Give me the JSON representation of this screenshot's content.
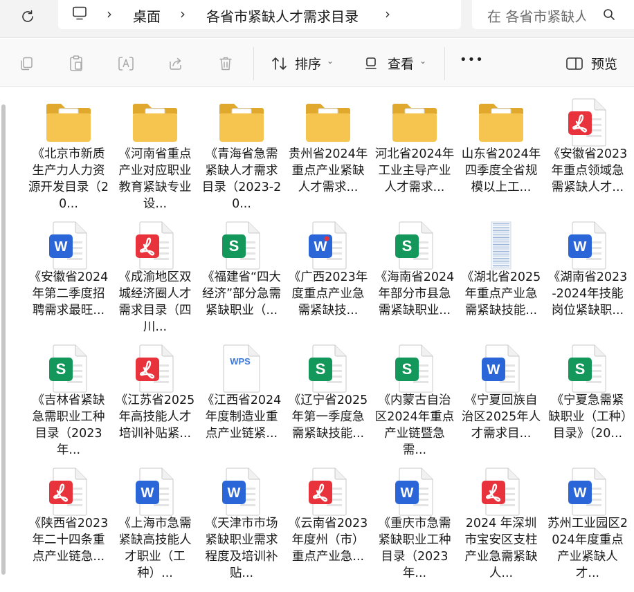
{
  "addressbar": {
    "crumbs": [
      "桌面",
      "各省市紧缺人才需求目录"
    ],
    "search_placeholder": "在 各省市紧缺人才需求目录 中搜索"
  },
  "toolbar": {
    "sort_label": "排序",
    "view_label": "查看",
    "more_label": "•••",
    "preview_label": "预览"
  },
  "colors": {
    "pdf": "#e8333c",
    "word": "#2b66d9",
    "sheet": "#14975a",
    "wps": "#3c78d8",
    "folder": "#f5c550"
  },
  "files": [
    {
      "type": "folder",
      "badge": "pdf",
      "name": "《北京市新质生产力人力资源开发目录（20..."
    },
    {
      "type": "folder",
      "badge": "pdf",
      "name": "《河南省重点产业对应职业教育紧缺专业设..."
    },
    {
      "type": "folder",
      "badge": "sheet",
      "name": "《青海省急需紧缺人才需求目录（2023-20..."
    },
    {
      "type": "folder",
      "badge": "sheet",
      "name": "贵州省2024年重点产业紧缺人才需求..."
    },
    {
      "type": "folder",
      "badge": "sheet",
      "name": "河北省2024年工业主导产业人才需求..."
    },
    {
      "type": "folder",
      "badge": "word",
      "name": "山东省2024年四季度全省规模以上工..."
    },
    {
      "type": "pdf",
      "name": "《安徽省2023年重点领域急需紧缺人才..."
    },
    {
      "type": "word",
      "name": "《安徽省2024年第二季度招聘需求最旺..."
    },
    {
      "type": "pdf",
      "name": "《成渝地区双城经济圈人才需求目录（四川..."
    },
    {
      "type": "sheet",
      "name": "《福建省“四大经济”部分急需紧缺职业（..."
    },
    {
      "type": "word-dot",
      "name": "《广西2023年度重点产业急需紧缺技..."
    },
    {
      "type": "sheet",
      "name": "《海南省2024年部分市县急需紧缺职业..."
    },
    {
      "type": "spreadsheet-thumb",
      "name": "《湖北省2025年重点产业急需紧缺技能..."
    },
    {
      "type": "word",
      "name": "《湖南省2023-2024年技能岗位紧缺职..."
    },
    {
      "type": "sheet",
      "name": "《吉林省紧缺急需职业工种目录（2023年..."
    },
    {
      "type": "pdf",
      "name": "《江苏省2025年高技能人才培训补贴紧..."
    },
    {
      "type": "wps",
      "name": "《江西省2024年度制造业重点产业链紧..."
    },
    {
      "type": "sheet",
      "name": "《辽宁省2025年第一季度急需紧缺技能..."
    },
    {
      "type": "sheet",
      "name": "《内蒙古自治区2024年重点产业链暨急需..."
    },
    {
      "type": "word",
      "name": "《宁夏回族自治区2025年人才需求目..."
    },
    {
      "type": "sheet",
      "name": "《宁夏急需紧缺职业（工种）目录》（20..."
    },
    {
      "type": "pdf",
      "name": "《陕西省2023年二十四条重点产业链急..."
    },
    {
      "type": "word",
      "name": "《上海市急需紧缺高技能人才职业（工种）..."
    },
    {
      "type": "word",
      "name": "《天津市市场紧缺职业需求程度及培训补贴..."
    },
    {
      "type": "pdf",
      "name": "《云南省2023年度州（市）重点产业急..."
    },
    {
      "type": "word",
      "name": "《重庆市急需紧缺职业工种目录（2023年..."
    },
    {
      "type": "pdf",
      "name": "2024 年深圳市宝安区支柱产业急需紧缺人..."
    },
    {
      "type": "word",
      "name": "苏州工业园区2024年度重点产业紧缺人才..."
    }
  ]
}
